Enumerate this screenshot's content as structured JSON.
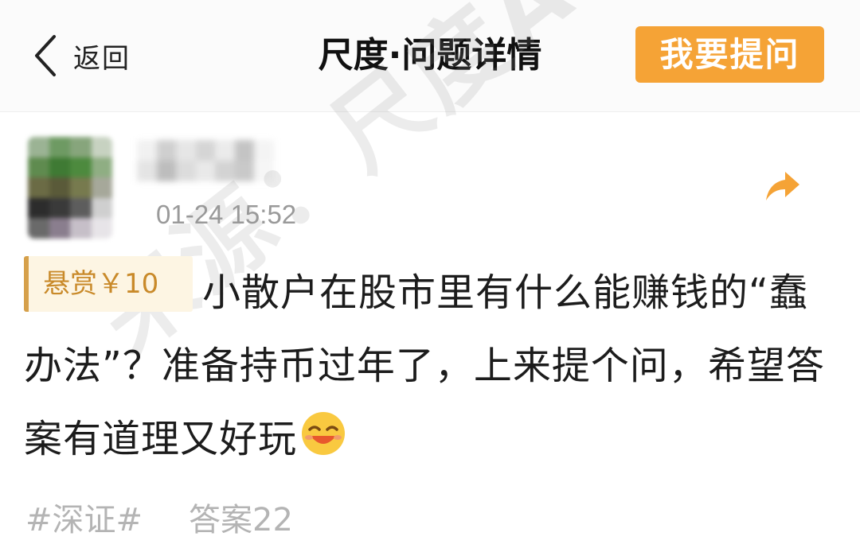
{
  "header": {
    "back_label": "返回",
    "title": "尺度·问题详情",
    "ask_button_label": "我要提问"
  },
  "post": {
    "timestamp": "01-24 15:52",
    "bounty_label": "悬赏￥10",
    "question_text": "小散户在股市里有什么能赚钱的“蠢办法”？准备持币过年了，上来提个问，希望答案有道理又好玩",
    "emoji": "smiling-face-emoji",
    "tag": "#深证#",
    "answers_label": "答案22"
  },
  "watermark": "来源：尺度APP",
  "colors": {
    "accent": "#f5a336",
    "bounty_text": "#c98a2a",
    "bounty_bg": "#fdf5e3",
    "muted": "#b4b4b4"
  }
}
